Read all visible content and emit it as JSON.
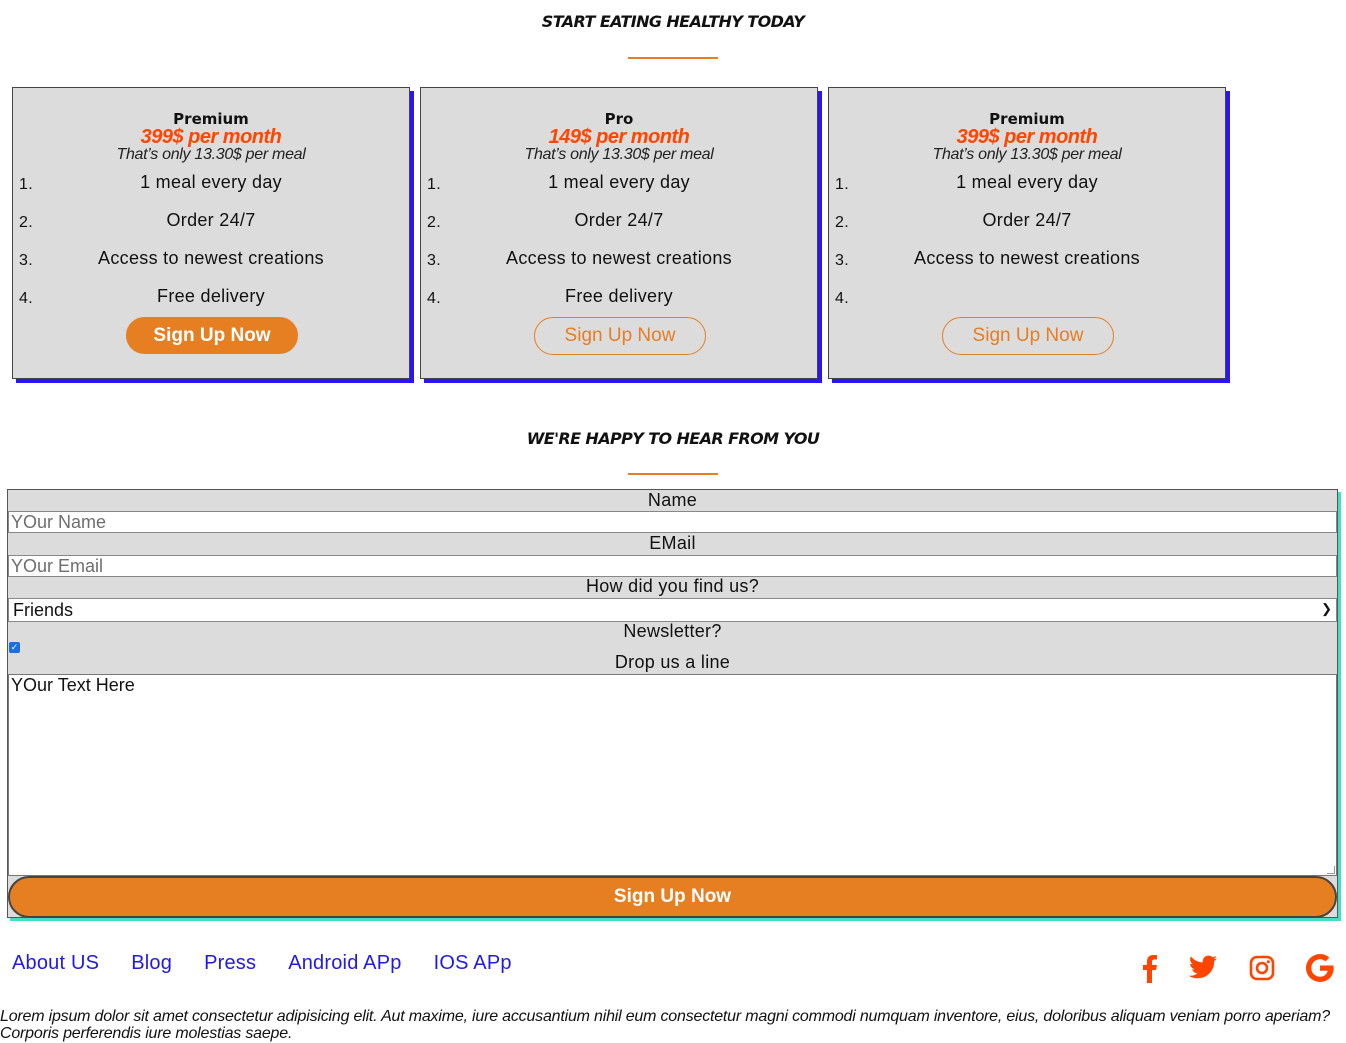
{
  "pricing": {
    "title": "START EATING HEALTHY TODAY",
    "plans": [
      {
        "name": "Premium",
        "price": "399$ per month",
        "sub": "That’s only 13.30$ per meal",
        "features": [
          "1 meal every day",
          "Order 24/7",
          "Access to newest creations",
          "Free delivery"
        ],
        "button": "Sign Up Now",
        "style": "filled"
      },
      {
        "name": "Pro",
        "price": "149$ per month",
        "sub": "That’s only 13.30$ per meal",
        "features": [
          "1 meal every day",
          "Order 24/7",
          "Access to newest creations",
          "Free delivery"
        ],
        "button": "Sign Up Now",
        "style": "outline"
      },
      {
        "name": "Premium",
        "price": "399$ per month",
        "sub": "That’s only 13.30$ per meal",
        "features": [
          "1 meal every day",
          "Order 24/7",
          "Access to newest creations",
          ""
        ],
        "button": "Sign Up Now",
        "style": "outline"
      }
    ],
    "numbers": [
      "1.",
      "2.",
      "3.",
      "4."
    ]
  },
  "contact": {
    "title": "WE'RE HAPPY TO HEAR FROM YOU",
    "name_label": "Name",
    "name_placeholder": "YOur Name",
    "email_label": "EMail",
    "email_placeholder": "YOur Email",
    "find_label": "How did you find us?",
    "find_value": "Friends",
    "newsletter_label": "Newsletter?",
    "newsletter_checked": true,
    "message_label": "Drop us a line",
    "message_value": "YOur Text Here",
    "submit_label": "Sign Up Now"
  },
  "footer": {
    "links": [
      "About US",
      "Blog",
      "Press",
      "Android APp",
      "IOS APp"
    ],
    "social_icons": [
      "facebook-icon",
      "twitter-icon",
      "instagram-icon",
      "google-icon"
    ],
    "text": "Lorem ipsum dolor sit amet consectetur adipisicing elit. Aut maxime, iure accusantium nihil eum consectetur magni commodi numquam inventore, eius, doloribus aliquam veniam porro aperiam? Corporis perferendis iure molestias saepe."
  },
  "colors": {
    "accent": "#e67e22",
    "price": "#ff4500",
    "shadow": "#2a16f5",
    "link": "#2019e8"
  }
}
